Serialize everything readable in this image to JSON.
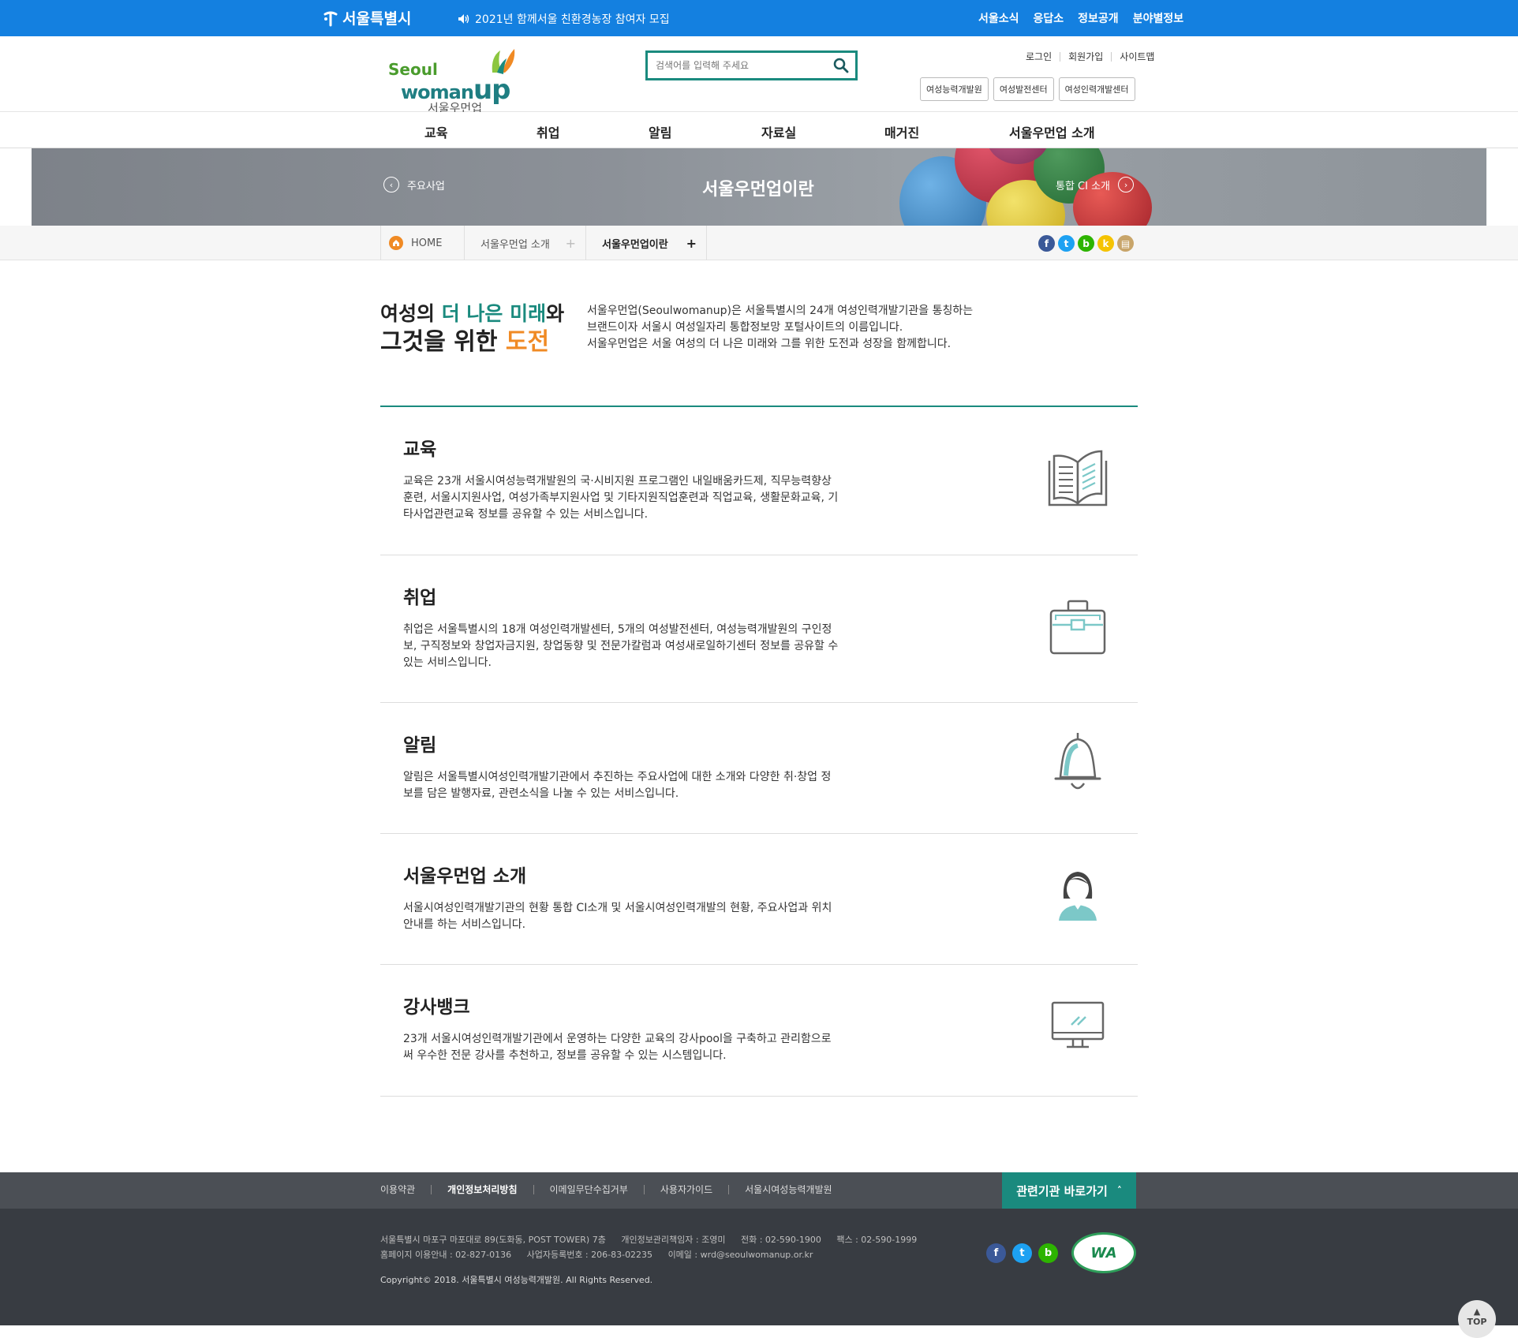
{
  "topbar": {
    "seoul_logo": "서울특별시",
    "notice": "2021년 함께서울 친환경농장 참여자 모집",
    "links": [
      "서울소식",
      "응답소",
      "정보공개",
      "분야별정보"
    ]
  },
  "header": {
    "logo": {
      "line1": "Seoul",
      "line2a": "woman",
      "line2b": "up",
      "line3": "서울우먼업"
    },
    "search_placeholder": "검색어를 입력해 주세요",
    "links": [
      "로그인",
      "회원가입",
      "사이트맵"
    ],
    "buttons": [
      "여성능력개발원",
      "여성발전센터",
      "여성인력개발센터"
    ]
  },
  "gnb": [
    "교육",
    "취업",
    "알림",
    "자료실",
    "매거진",
    "서울우먼업 소개"
  ],
  "banner": {
    "title": "서울우먼업이란",
    "prev": "주요사업",
    "next": "통합 CI 소개"
  },
  "breadcrumb": {
    "home": "HOME",
    "level1": "서울우먼업 소개",
    "level2": "서울우먼업이란"
  },
  "sns_icons": [
    "facebook-icon",
    "twitter-icon",
    "band-icon",
    "kakaostory-icon",
    "print-icon"
  ],
  "intro": {
    "head_l1a": "여성의 ",
    "head_l1b": "더 나은 미래",
    "head_l1c": "와",
    "head_l2a": "그것을 위한 ",
    "head_l2b": "도전",
    "text": [
      "서울우먼업(Seoulwomanup)은 서울특별시의 24개 여성인력개발기관을 통칭하는",
      "브랜드이자 서울시 여성일자리 통합정보망 포털사이트의 이름입니다.",
      "서울우먼업은 서울 여성의 더 나은 미래와 그를 위한 도전과 성장을 함께합니다."
    ]
  },
  "sections": [
    {
      "title": "교육",
      "lines": [
        "교육은 23개 서울시여성능력개발원의 국·시비지원 프로그램인 내일배움카드제, 직무능력향상",
        "훈련, 서울시지원사업, 여성가족부지원사업 및 기타지원직업훈련과 직업교육, 생활문화교육, 기",
        "타사업관련교육 정보를 공유할 수 있는 서비스입니다."
      ]
    },
    {
      "title": "취업",
      "lines": [
        "취업은 서울특별시의 18개 여성인력개발센터, 5개의 여성발전센터, 여성능력개발원의 구인정",
        "보, 구직정보와 창업자금지원, 창업동향 및 전문가칼럼과 여성새로일하기센터 정보를 공유할 수",
        "있는 서비스입니다."
      ]
    },
    {
      "title": "알림",
      "lines": [
        "알림은 서울특별시여성인력개발기관에서 추진하는 주요사업에 대한 소개와 다양한 취·창업 정",
        "보를 담은 발행자료, 관련소식을 나눌 수 있는 서비스입니다."
      ]
    },
    {
      "title": "서울우먼업 소개",
      "lines": [
        "서울시여성인력개발기관의 현황 통합 CI소개 및 서울시여성인력개발의 현황, 주요사업과 위치",
        "안내를 하는 서비스입니다."
      ]
    },
    {
      "title": "강사뱅크",
      "lines": [
        "23개 서울시여성인력개발기관에서 운영하는 다양한 교육의 강사pool을 구축하고 관리함으로",
        "써 우수한 전문 강사를 추천하고, 정보를 공유할 수 있는 시스템입니다."
      ]
    }
  ],
  "footer": {
    "links": [
      "이용약관",
      "개인정보처리방침",
      "이메일무단수집거부",
      "사용자가이드",
      "서울시여성능력개발원"
    ],
    "related": "관련기관 바로가기",
    "addr1": [
      "서울특별시 마포구 마포대로 89(도화동, POST TOWER) 7층",
      "개인정보관리책임자 : 조영미",
      "전화 : 02-590-1900",
      "팩스 : 02-590-1999"
    ],
    "addr2": [
      "홈페이지 이용안내 : 02-827-0136",
      "사업자등록번호 : 206-83-02235",
      "이메일 : wrd@seoulwomanup.or.kr"
    ],
    "copyright": "Copyright© 2018. 서울특별시 여성능력개발원. All Rights Reserved.",
    "wa_mark": "WA",
    "top": "TOP"
  },
  "colors": {
    "topbar": "#1480e0",
    "teal": "#1a8a7e",
    "orange": "#f08a24",
    "footer": "#383c42"
  }
}
